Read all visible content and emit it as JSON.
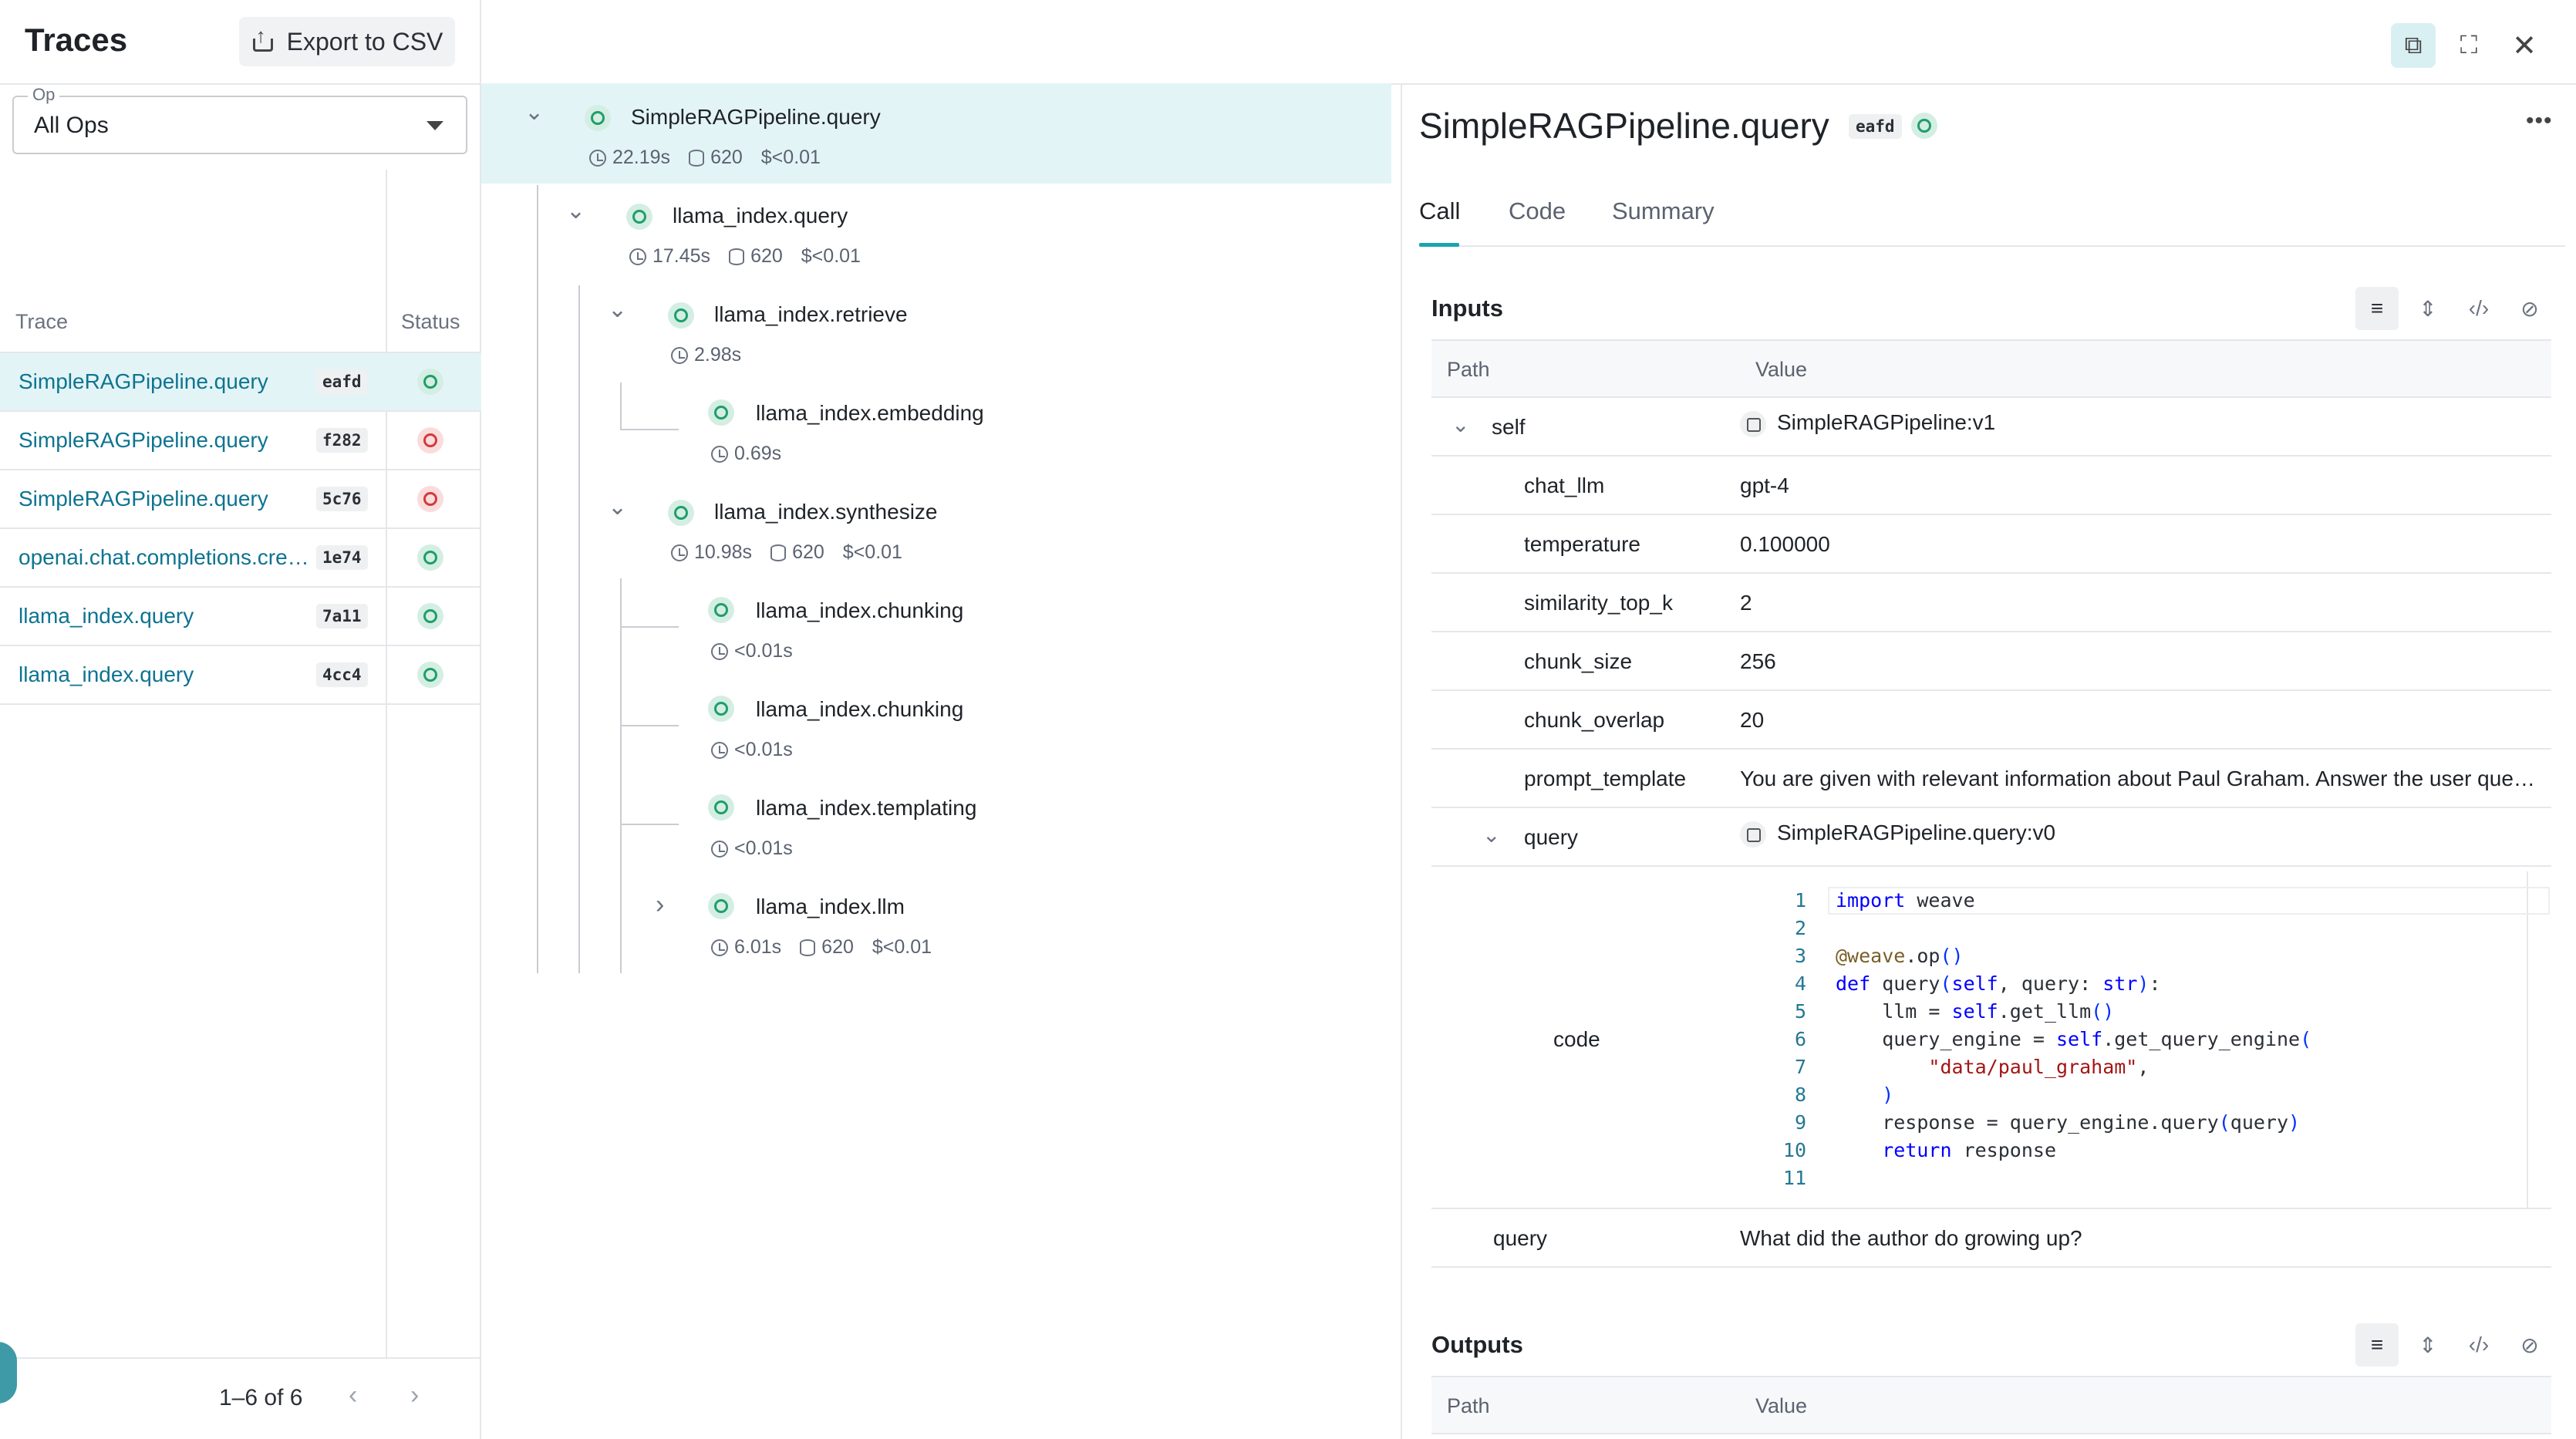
{
  "left_panel": {
    "title": "Traces",
    "export_label": "Export to CSV",
    "op_filter": {
      "label": "Op",
      "value": "All Ops"
    },
    "columns": {
      "trace": "Trace",
      "status": "Status"
    },
    "rows": [
      {
        "name": "SimpleRAGPipeline.query",
        "id": "eafd",
        "status": "success"
      },
      {
        "name": "SimpleRAGPipeline.query",
        "id": "f282",
        "status": "error"
      },
      {
        "name": "SimpleRAGPipeline.query",
        "id": "5c76",
        "status": "error"
      },
      {
        "name": "openai.chat.completions.cre…",
        "id": "1e74",
        "status": "success"
      },
      {
        "name": "llama_index.query",
        "id": "7a11",
        "status": "success"
      },
      {
        "name": "llama_index.query",
        "id": "4cc4",
        "status": "success"
      }
    ],
    "pagination": {
      "text": "1–6 of 6"
    }
  },
  "tree": {
    "nodes": [
      {
        "name": "SimpleRAGPipeline.query",
        "time": "22.19s",
        "tokens": "620",
        "cost": "$<0.01"
      },
      {
        "name": "llama_index.query",
        "time": "17.45s",
        "tokens": "620",
        "cost": "$<0.01"
      },
      {
        "name": "llama_index.retrieve",
        "time": "2.98s"
      },
      {
        "name": "llama_index.embedding",
        "time": "0.69s"
      },
      {
        "name": "llama_index.synthesize",
        "time": "10.98s",
        "tokens": "620",
        "cost": "$<0.01"
      },
      {
        "name": "llama_index.chunking",
        "time": "<0.01s"
      },
      {
        "name": "llama_index.chunking",
        "time": "<0.01s"
      },
      {
        "name": "llama_index.templating",
        "time": "<0.01s"
      },
      {
        "name": "llama_index.llm",
        "time": "6.01s",
        "tokens": "620",
        "cost": "$<0.01"
      }
    ]
  },
  "detail": {
    "title": "SimpleRAGPipeline.query",
    "id": "eafd",
    "tabs": [
      "Call",
      "Code",
      "Summary"
    ],
    "inputs": {
      "title": "Inputs",
      "col_path": "Path",
      "col_value": "Value",
      "self": {
        "key": "self",
        "value": "SimpleRAGPipeline:v1"
      },
      "params": [
        {
          "key": "chat_llm",
          "value": "gpt-4"
        },
        {
          "key": "temperature",
          "value": "0.100000"
        },
        {
          "key": "similarity_top_k",
          "value": "2"
        },
        {
          "key": "chunk_size",
          "value": "256"
        },
        {
          "key": "chunk_overlap",
          "value": "20"
        },
        {
          "key": "prompt_template",
          "value": "You are given with relevant information about Paul Graham. Answer the user query on…"
        }
      ],
      "query_ref": {
        "key": "query",
        "value": "SimpleRAGPipeline.query:v0"
      },
      "code_key": "code",
      "code_lines": [
        "import weave",
        "",
        "@weave.op()",
        "def query(self, query: str):",
        "    llm = self.get_llm()",
        "    query_engine = self.get_query_engine(",
        "        \"data/paul_graham\",",
        "    )",
        "    response = query_engine.query(query)",
        "    return response",
        ""
      ],
      "query_arg": {
        "key": "query",
        "value": "What did the author do growing up?"
      }
    },
    "outputs": {
      "title": "Outputs",
      "col_path": "Path",
      "col_value": "Value"
    }
  },
  "colors": {
    "accent": "#1aa3b0",
    "link": "#0e7490",
    "success": "#1f9e6b",
    "error": "#d33a3a"
  }
}
